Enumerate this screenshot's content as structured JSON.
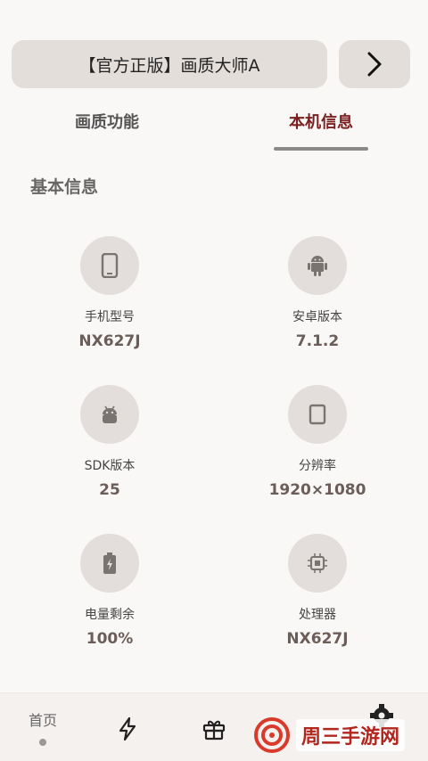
{
  "header": {
    "title": "【官方正版】画质大师A"
  },
  "tabs": [
    {
      "label": "画质功能",
      "active": false
    },
    {
      "label": "本机信息",
      "active": true
    }
  ],
  "section": {
    "title": "基本信息"
  },
  "info": [
    {
      "icon": "phone-icon",
      "label": "手机型号",
      "value": "NX627J"
    },
    {
      "icon": "android-icon",
      "label": "安卓版本",
      "value": "7.1.2"
    },
    {
      "icon": "android-head-icon",
      "label": "SDK版本",
      "value": "25"
    },
    {
      "icon": "screen-icon",
      "label": "分辨率",
      "value": "1920×1080"
    },
    {
      "icon": "battery-icon",
      "label": "电量剩余",
      "value": "100%"
    },
    {
      "icon": "chip-icon",
      "label": "处理器",
      "value": "NX627J"
    }
  ],
  "nav": {
    "home_label": "首页",
    "items": [
      "lightning-icon",
      "gift-icon",
      "gear-icon"
    ]
  },
  "watermark": {
    "text": "周三手游网"
  },
  "colors": {
    "accent": "#7a1f1f",
    "card": "#e3deda",
    "background": "#faf8f7",
    "watermark": "#b3261e"
  }
}
